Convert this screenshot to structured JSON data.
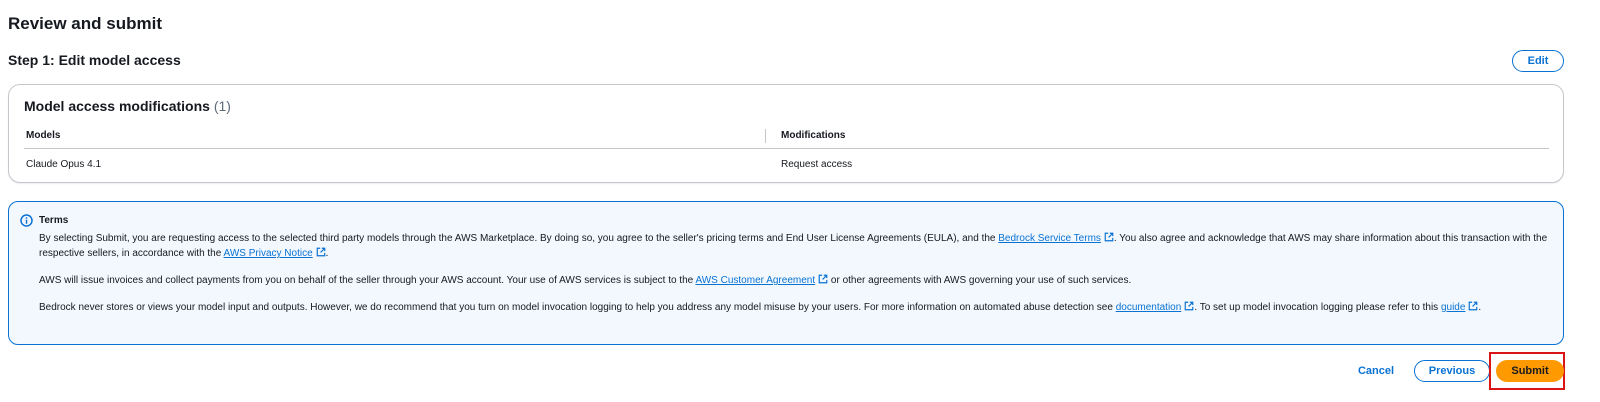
{
  "page": {
    "title": "Review and submit"
  },
  "step": {
    "title": "Step 1: Edit model access",
    "edit_label": "Edit"
  },
  "card": {
    "title": "Model access modifications",
    "count": "(1)",
    "columns": [
      "Models",
      "Modifications"
    ],
    "rows": [
      {
        "model": "Claude Opus 4.1",
        "modification": "Request access"
      }
    ]
  },
  "terms": {
    "title": "Terms",
    "p1_a": "By selecting Submit, you are requesting access to the selected third party models through the AWS Marketplace. By doing so, you agree to the seller's pricing terms and End User License Agreements (EULA), and the ",
    "p1_link1": "Bedrock Service Terms",
    "p1_b": ". You also agree and acknowledge that AWS may share information about this transaction with the respective sellers, in accordance with the ",
    "p1_link2": "AWS Privacy Notice",
    "p1_c": ".",
    "p2_a": "AWS will issue invoices and collect payments from you on behalf of the seller through your AWS account. Your use of AWS services is subject to the ",
    "p2_link1": "AWS Customer Agreement",
    "p2_b": " or other agreements with AWS governing your use of such services.",
    "p3_a": "Bedrock never stores or views your model input and outputs. However, we do recommend that you turn on model invocation logging to help you address any model misuse by your users. For more information on automated abuse detection see ",
    "p3_link1": "documentation",
    "p3_b": ". To set up model invocation logging please refer to this ",
    "p3_link2": "guide",
    "p3_c": "."
  },
  "footer": {
    "cancel_label": "Cancel",
    "previous_label": "Previous",
    "submit_label": "Submit"
  },
  "colors": {
    "link": "#0972d3",
    "primary_button": "#ff9900",
    "alert_background": "#f2f8fd",
    "highlight": "#d91515"
  },
  "icons": {
    "info": "info-icon",
    "external": "external-link-icon"
  }
}
